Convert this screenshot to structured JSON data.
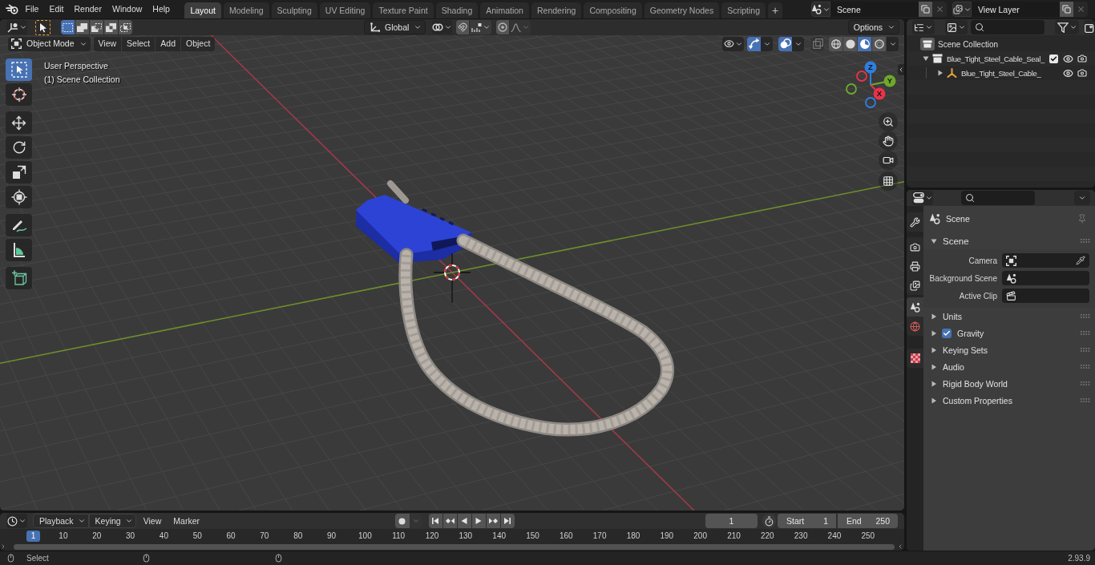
{
  "topbar": {
    "menus": [
      "File",
      "Edit",
      "Render",
      "Window",
      "Help"
    ],
    "workspaces": [
      {
        "label": "Layout",
        "selected": true
      },
      {
        "label": "Modeling",
        "selected": false
      },
      {
        "label": "Sculpting",
        "selected": false
      },
      {
        "label": "UV Editing",
        "selected": false
      },
      {
        "label": "Texture Paint",
        "selected": false
      },
      {
        "label": "Shading",
        "selected": false
      },
      {
        "label": "Animation",
        "selected": false
      },
      {
        "label": "Rendering",
        "selected": false
      },
      {
        "label": "Compositing",
        "selected": false
      },
      {
        "label": "Geometry Nodes",
        "selected": false
      },
      {
        "label": "Scripting",
        "selected": false
      }
    ],
    "add_workspace": "+",
    "scene": "Scene",
    "view_layer": "View Layer"
  },
  "tool_header": {
    "select_modes": [
      {
        "kind": "set",
        "selected": true
      },
      {
        "kind": "extend",
        "selected": false
      },
      {
        "kind": "subtract",
        "selected": false
      },
      {
        "kind": "invert",
        "selected": false
      },
      {
        "kind": "intersect",
        "selected": false
      }
    ],
    "orientation": "Global",
    "options": "Options"
  },
  "viewport_header": {
    "mode": "Object Mode",
    "menus": [
      "View",
      "Select",
      "Add",
      "Object"
    ],
    "gizmos": true,
    "overlays": true,
    "shading": [
      {
        "kind": "wireframe",
        "selected": false
      },
      {
        "kind": "solid",
        "selected": false
      },
      {
        "kind": "material",
        "selected": true
      },
      {
        "kind": "rendered",
        "selected": false
      }
    ]
  },
  "viewport": {
    "tool_groups": [
      [
        {
          "kind": "select_box",
          "selected": true
        },
        {
          "kind": "cursor",
          "selected": false
        }
      ],
      [
        {
          "kind": "move",
          "selected": false
        },
        {
          "kind": "rotate",
          "selected": false
        },
        {
          "kind": "scale",
          "selected": false
        },
        {
          "kind": "transform",
          "selected": false
        }
      ],
      [
        {
          "kind": "annotate",
          "selected": false
        },
        {
          "kind": "measure",
          "selected": false
        }
      ],
      [
        {
          "kind": "add_cube",
          "selected": false
        }
      ]
    ],
    "overlay_text": [
      "User Perspective",
      "(1) Scene Collection"
    ],
    "gizmo_axes": [
      {
        "label": "Z",
        "color": "#2f7fe0"
      },
      {
        "label": "Y",
        "color": "#6fa82c"
      },
      {
        "label": "X",
        "color": "#e8334a"
      }
    ]
  },
  "outliner": {
    "root": "Scene Collection",
    "items": [
      {
        "label": "Blue_Tight_Steel_Cable_Seal_",
        "kind": "collection",
        "expanded": true,
        "checked": true,
        "children": [
          {
            "label": "Blue_Tight_Steel_Cable_",
            "kind": "empty",
            "expanded": false
          }
        ]
      }
    ]
  },
  "properties": {
    "tab_groups": [
      [
        {
          "kind": "tool",
          "selected": false
        }
      ],
      [
        {
          "kind": "render",
          "selected": false
        },
        {
          "kind": "output",
          "selected": false
        },
        {
          "kind": "view_layer",
          "selected": false
        }
      ],
      [
        {
          "kind": "scene",
          "selected": true
        },
        {
          "kind": "world",
          "selected": false
        }
      ],
      [
        {
          "kind": "texture",
          "selected": false
        }
      ]
    ],
    "context": "Scene",
    "panel": {
      "title": "Scene",
      "expanded": true,
      "fields": [
        {
          "label": "Camera",
          "kind": "camera"
        },
        {
          "label": "Background Scene",
          "kind": "scene"
        },
        {
          "label": "Active Clip",
          "kind": "clip"
        }
      ]
    },
    "subpanels": [
      {
        "label": "Units",
        "kind": "plain",
        "expanded": false
      },
      {
        "label": "Gravity",
        "kind": "toggle",
        "checked": true,
        "expanded": false
      },
      {
        "label": "Keying Sets",
        "kind": "plain",
        "expanded": false
      },
      {
        "label": "Audio",
        "kind": "plain",
        "expanded": false
      },
      {
        "label": "Rigid Body World",
        "kind": "plain",
        "expanded": false
      },
      {
        "label": "Custom Properties",
        "kind": "plain",
        "expanded": false
      }
    ]
  },
  "timeline": {
    "menus": [
      {
        "label": "Playback",
        "kind": "dropdown"
      },
      {
        "label": "Keying",
        "kind": "dropdown"
      },
      {
        "label": "View",
        "kind": "menu"
      },
      {
        "label": "Marker",
        "kind": "menu"
      }
    ],
    "current_frame": "1",
    "start": {
      "label": "Start",
      "value": "1"
    },
    "end": {
      "label": "End",
      "value": "250"
    },
    "ruler": [
      "10",
      "20",
      "30",
      "40",
      "50",
      "60",
      "70",
      "80",
      "90",
      "100",
      "110",
      "120",
      "130",
      "140",
      "150",
      "160",
      "170",
      "180",
      "190",
      "200",
      "210",
      "220",
      "230",
      "240",
      "250"
    ],
    "playhead": "1"
  },
  "status_bar": {
    "hint": "Select",
    "version": "2.93.9"
  }
}
